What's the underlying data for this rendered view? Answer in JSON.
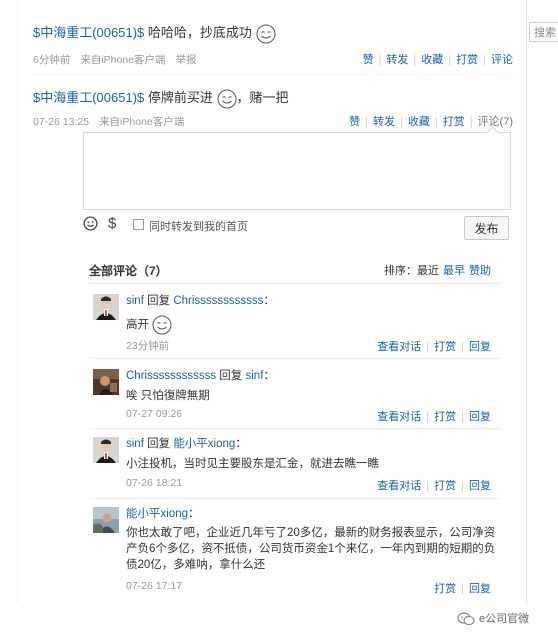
{
  "search": {
    "placeholder": "搜索"
  },
  "post1": {
    "stock": "$中海重工(00651)$",
    "text": " 哈哈哈，抄底成功",
    "meta": {
      "time": "6分钟前",
      "source": "来自iPhone客户端",
      "report": "举报"
    },
    "actions": [
      "赞",
      "转发",
      "收藏",
      "打赏",
      "评论"
    ]
  },
  "post2": {
    "stock": "$中海重工(00651)$",
    "text_before": " 停牌前买进",
    "text_after": "，赌一把",
    "meta": {
      "time": "07-26 13:25",
      "source": "来自iPhone客户端"
    },
    "actions": [
      "赞",
      "转发",
      "收藏",
      "打赏",
      "评论(7)"
    ]
  },
  "composer": {
    "repost_label": "同时转发到我的首页",
    "publish": "发布",
    "dollar": "$"
  },
  "comments": {
    "title": "全部评论（7）",
    "sort_label": "排序：最近",
    "sort_options": [
      "最早",
      "赞助"
    ],
    "items": [
      {
        "user": "sinf",
        "reply": "回复",
        "target": "Chrissssssssssss",
        "colon": "：",
        "text": "高开",
        "time": "23分钟前",
        "actions": [
          "查看对话",
          "打赏",
          "回复"
        ]
      },
      {
        "user": "Chrissssssssssss",
        "reply": "回复",
        "target": "sinf",
        "colon": "：",
        "text": "唉 只怕復牌無期",
        "time": "07-27 09:26",
        "actions": [
          "查看对话",
          "打赏",
          "回复"
        ]
      },
      {
        "user": "sinf",
        "reply": "回复",
        "target": "能小平xiong",
        "colon": "：",
        "text": "小注投机，当时见主要股东是汇金，就进去瞧一瞧",
        "time": "07-26 18:21",
        "actions": [
          "查看对话",
          "打赏",
          "回复"
        ]
      },
      {
        "user": "能小平xiong",
        "reply": "",
        "target": "",
        "colon": "：",
        "text_lines": [
          "你也太敢了吧，企业近几年亏了20多亿，最新的财务报表显示，公司净资",
          "产负6个多亿，资不抵债，公司货币资金1个来亿，一年内到期的短期的负",
          "债20亿，多难呐，拿什么还"
        ],
        "time": "07-26 17:17",
        "actions": [
          "打赏",
          "回复"
        ]
      }
    ]
  },
  "watermark": {
    "text": "e公司官微"
  }
}
